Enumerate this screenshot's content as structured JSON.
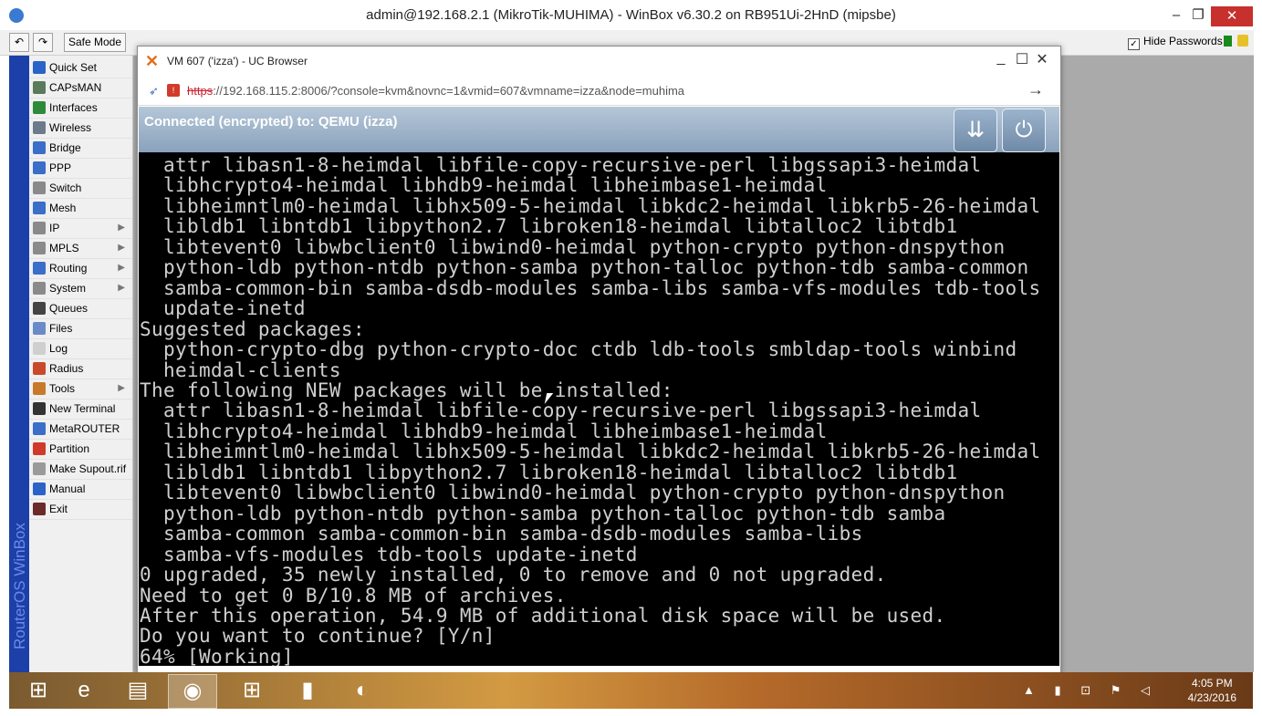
{
  "winbox": {
    "title": "admin@192.168.2.1 (MikroTik-MUHIMA) - WinBox v6.30.2 on RB951Ui-2HnD (mipsbe)",
    "undo_icon": "undo-icon",
    "redo_icon": "redo-icon",
    "safe_mode_label": "Safe Mode",
    "hide_passwords_label": "Hide Passwords",
    "hide_passwords_checked": "✓",
    "side_stripe_text": "RouterOS WinBox",
    "menu": [
      {
        "label": "Quick Set",
        "icon": "quick-set-icon",
        "color": "#2a62c8",
        "arrow": ""
      },
      {
        "label": "CAPsMAN",
        "icon": "capsman-icon",
        "color": "#5a7a5a",
        "arrow": ""
      },
      {
        "label": "Interfaces",
        "icon": "interfaces-icon",
        "color": "#2c8a3a",
        "arrow": ""
      },
      {
        "label": "Wireless",
        "icon": "wireless-icon",
        "color": "#6b7b8b",
        "arrow": ""
      },
      {
        "label": "Bridge",
        "icon": "bridge-icon",
        "color": "#3a6ec8",
        "arrow": ""
      },
      {
        "label": "PPP",
        "icon": "ppp-icon",
        "color": "#3a6ec8",
        "arrow": ""
      },
      {
        "label": "Switch",
        "icon": "switch-icon",
        "color": "#8a8a8a",
        "arrow": ""
      },
      {
        "label": "Mesh",
        "icon": "mesh-icon",
        "color": "#3a6ec8",
        "arrow": ""
      },
      {
        "label": "IP",
        "icon": "ip-icon",
        "color": "#8a8a8a",
        "arrow": "▶"
      },
      {
        "label": "MPLS",
        "icon": "mpls-icon",
        "color": "#8a8a8a",
        "arrow": "▶"
      },
      {
        "label": "Routing",
        "icon": "routing-icon",
        "color": "#3a6ec8",
        "arrow": "▶"
      },
      {
        "label": "System",
        "icon": "system-icon",
        "color": "#8a8a8a",
        "arrow": "▶"
      },
      {
        "label": "Queues",
        "icon": "queues-icon",
        "color": "#444444",
        "arrow": ""
      },
      {
        "label": "Files",
        "icon": "files-icon",
        "color": "#6b8bc8",
        "arrow": ""
      },
      {
        "label": "Log",
        "icon": "log-icon",
        "color": "#cfcfcf",
        "arrow": ""
      },
      {
        "label": "Radius",
        "icon": "radius-icon",
        "color": "#c84a2a",
        "arrow": ""
      },
      {
        "label": "Tools",
        "icon": "tools-icon",
        "color": "#c87a2a",
        "arrow": "▶"
      },
      {
        "label": "New Terminal",
        "icon": "terminal-icon",
        "color": "#333333",
        "arrow": ""
      },
      {
        "label": "MetaROUTER",
        "icon": "metarouter-icon",
        "color": "#3a6ec8",
        "arrow": ""
      },
      {
        "label": "Partition",
        "icon": "partition-icon",
        "color": "#d03a2a",
        "arrow": ""
      },
      {
        "label": "Make Supout.rif",
        "icon": "supout-icon",
        "color": "#9a9a9a",
        "arrow": ""
      },
      {
        "label": "Manual",
        "icon": "manual-icon",
        "color": "#2a62c8",
        "arrow": ""
      },
      {
        "label": "Exit",
        "icon": "exit-icon",
        "color": "#6a2a2a",
        "arrow": ""
      }
    ]
  },
  "browser": {
    "title": "VM 607 ('izza') - UC Browser",
    "url_scheme": "https",
    "url_rest": "://192.168.115.2:8006/?console=kvm&novnc=1&vmid=607&vmname=izza&node=muhima",
    "go_arrow": "→"
  },
  "vnc": {
    "status": "Connected (encrypted) to: QEMU (izza)",
    "send_keys_icon": "send-keys-icon",
    "power_icon": "power-icon"
  },
  "terminal": {
    "lines": [
      "  attr libasn1-8-heimdal libfile-copy-recursive-perl libgssapi3-heimdal",
      "  libhcrypto4-heimdal libhdb9-heimdal libheimbase1-heimdal",
      "  libheimntlm0-heimdal libhx509-5-heimdal libkdc2-heimdal libkrb5-26-heimdal",
      "  libldb1 libntdb1 libpython2.7 libroken18-heimdal libtalloc2 libtdb1",
      "  libtevent0 libwbclient0 libwind0-heimdal python-crypto python-dnspython",
      "  python-ldb python-ntdb python-samba python-talloc python-tdb samba-common",
      "  samba-common-bin samba-dsdb-modules samba-libs samba-vfs-modules tdb-tools",
      "  update-inetd",
      "Suggested packages:",
      "  python-crypto-dbg python-crypto-doc ctdb ldb-tools smbldap-tools winbind",
      "  heimdal-clients",
      "The following NEW packages will be installed:",
      "  attr libasn1-8-heimdal libfile-copy-recursive-perl libgssapi3-heimdal",
      "  libhcrypto4-heimdal libhdb9-heimdal libheimbase1-heimdal",
      "  libheimntlm0-heimdal libhx509-5-heimdal libkdc2-heimdal libkrb5-26-heimdal",
      "  libldb1 libntdb1 libpython2.7 libroken18-heimdal libtalloc2 libtdb1",
      "  libtevent0 libwbclient0 libwind0-heimdal python-crypto python-dnspython",
      "  python-ldb python-ntdb python-samba python-talloc python-tdb samba",
      "  samba-common samba-common-bin samba-dsdb-modules samba-libs",
      "  samba-vfs-modules tdb-tools update-inetd",
      "0 upgraded, 35 newly installed, 0 to remove and 0 not upgraded.",
      "Need to get 0 B/10.8 MB of archives.",
      "After this operation, 54.9 MB of additional disk space will be used.",
      "Do you want to continue? [Y/n]",
      "64% [Working]"
    ]
  },
  "taskbar": {
    "items": [
      {
        "name": "start-button",
        "glyph": "⊞",
        "active": false
      },
      {
        "name": "internet-explorer-icon",
        "glyph": "e",
        "active": false
      },
      {
        "name": "file-explorer-icon",
        "glyph": "▤",
        "active": false
      },
      {
        "name": "uc-browser-icon",
        "glyph": "◉",
        "active": true
      },
      {
        "name": "store-icon",
        "glyph": "⊞",
        "active": false
      },
      {
        "name": "office-icon",
        "glyph": "▮",
        "active": false
      },
      {
        "name": "winbox-icon",
        "glyph": "◐",
        "active": false
      }
    ],
    "tray_icons": "▲ ▮ ⊡ ⚑ ◁",
    "time": "4:05 PM",
    "date": "4/23/2016"
  }
}
